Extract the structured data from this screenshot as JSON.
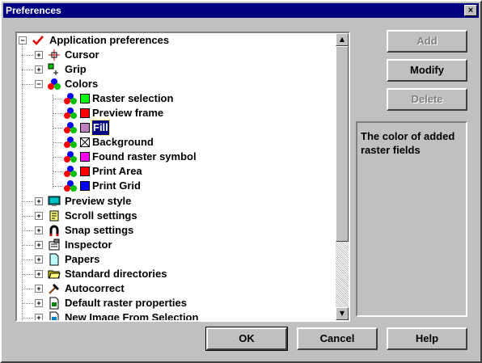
{
  "window": {
    "title": "Preferences"
  },
  "tree": {
    "root": "Application preferences",
    "items": [
      {
        "label": "Cursor",
        "icon": "crosshair-icon"
      },
      {
        "label": "Grip",
        "icon": "grip-icon"
      },
      {
        "label": "Colors",
        "icon": "colors-icon",
        "expanded": true
      },
      {
        "label": "Raster selection",
        "swatch": "#00ff00"
      },
      {
        "label": "Preview frame",
        "swatch": "#ff0000"
      },
      {
        "label": "Fill",
        "swatch": "#c080c0",
        "selected": true
      },
      {
        "label": "Background",
        "swatch": "none"
      },
      {
        "label": "Found raster symbol",
        "swatch": "#ff00ff"
      },
      {
        "label": "Print Area",
        "swatch": "#ff0000"
      },
      {
        "label": "Print Grid",
        "swatch": "#0000ff"
      },
      {
        "label": "Preview style",
        "icon": "monitor-icon"
      },
      {
        "label": "Scroll settings",
        "icon": "scroll-icon"
      },
      {
        "label": "Snap settings",
        "icon": "magnet-icon"
      },
      {
        "label": "Inspector",
        "icon": "inspector-icon"
      },
      {
        "label": "Papers",
        "icon": "paper-icon"
      },
      {
        "label": "Standard directories",
        "icon": "folder-icon"
      },
      {
        "label": "Autocorrect",
        "icon": "hammer-icon"
      },
      {
        "label": "Default raster properties",
        "icon": "raster-props-icon"
      },
      {
        "label": "New Image From Selection",
        "icon": "new-image-icon"
      }
    ]
  },
  "buttons": {
    "add": "Add",
    "modify": "Modify",
    "delete": "Delete",
    "ok": "OK",
    "cancel": "Cancel",
    "help": "Help"
  },
  "description": "The color of added raster fields",
  "close_glyph": "×"
}
